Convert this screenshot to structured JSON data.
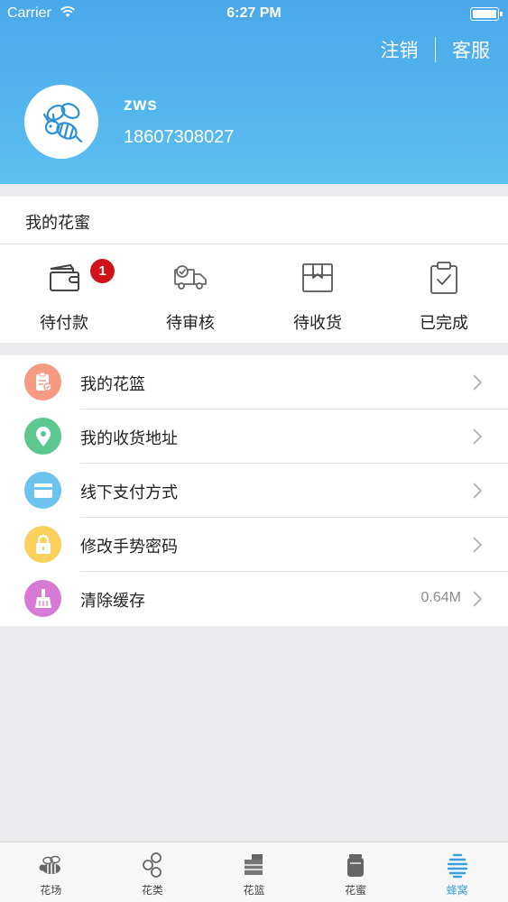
{
  "status_bar": {
    "carrier": "Carrier",
    "time": "6:27 PM"
  },
  "header": {
    "logout_label": "注销",
    "service_label": "客服",
    "username": "zws",
    "phone": "18607308027"
  },
  "orders": {
    "title": "我的花蜜",
    "pending_payment_badge": "1",
    "items": [
      {
        "label": "待付款",
        "icon": "wallet-icon"
      },
      {
        "label": "待审核",
        "icon": "delivery-truck-icon"
      },
      {
        "label": "待收货",
        "icon": "package-box-icon"
      },
      {
        "label": "已完成",
        "icon": "clipboard-check-icon"
      }
    ]
  },
  "menu": {
    "items": [
      {
        "label": "我的花篮",
        "icon": "basket-clipboard-icon",
        "color": "#f59b82"
      },
      {
        "label": "我的收货地址",
        "icon": "location-pin-icon",
        "color": "#5cc88f"
      },
      {
        "label": "线下支付方式",
        "icon": "card-icon",
        "color": "#6cc3ee"
      },
      {
        "label": "修改手势密码",
        "icon": "lock-icon",
        "color": "#f9d15c"
      },
      {
        "label": "清除缓存",
        "icon": "broom-icon",
        "color": "#d77ad6",
        "value": "0.64M"
      }
    ]
  },
  "tabbar": {
    "items": [
      {
        "label": "花场",
        "icon": "bee-icon"
      },
      {
        "label": "花类",
        "icon": "hexagons-icon"
      },
      {
        "label": "花篮",
        "icon": "basket-icon"
      },
      {
        "label": "花蜜",
        "icon": "honey-jar-icon"
      },
      {
        "label": "蜂窝",
        "icon": "beehive-icon",
        "active": true
      }
    ]
  },
  "colors": {
    "header_top": "#4aa8ea",
    "header_bottom": "#5bbff0",
    "badge": "#d0121b",
    "active_tab": "#3aa0e0"
  }
}
